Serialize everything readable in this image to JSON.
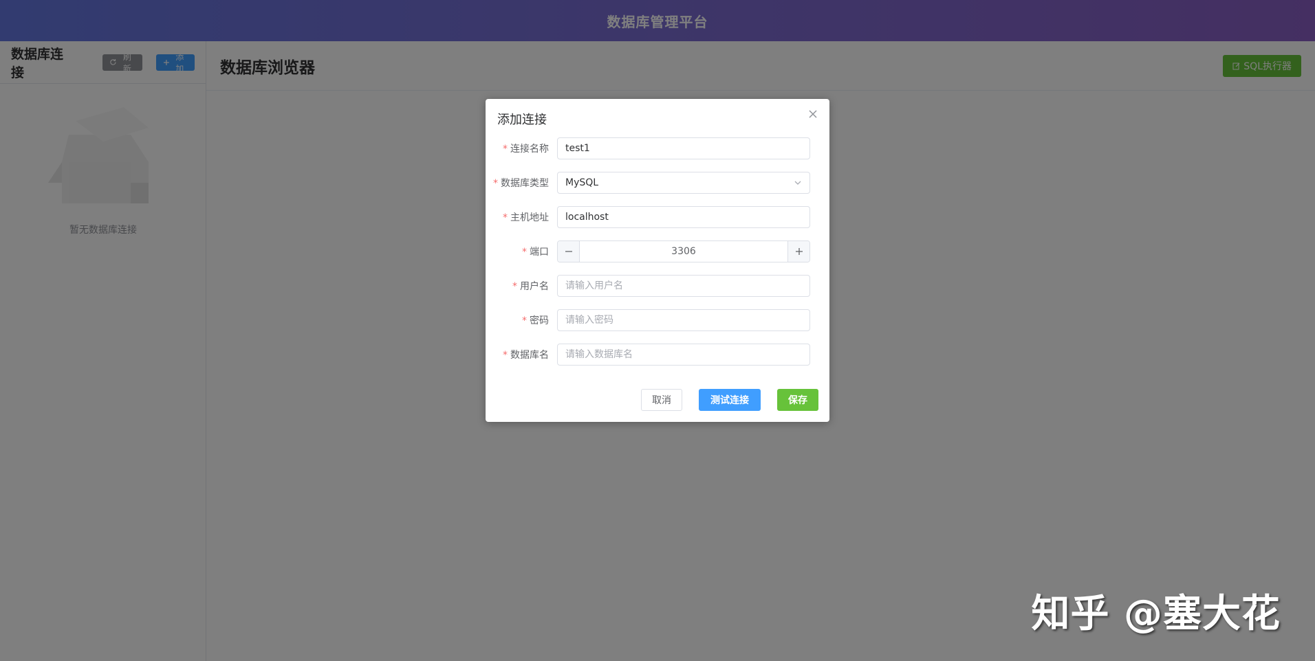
{
  "app": {
    "title": "数据库管理平台"
  },
  "sidebar": {
    "title": "数据库连接",
    "refresh_label": "刷新",
    "add_label": "添加",
    "empty_text": "暂无数据库连接"
  },
  "main": {
    "title": "数据库浏览器",
    "sql_button_label": "SQL执行器"
  },
  "dialog": {
    "title": "添加连接",
    "fields": {
      "name": {
        "label": "连接名称",
        "value": "test1"
      },
      "db_type": {
        "label": "数据库类型",
        "value": "MySQL"
      },
      "host": {
        "label": "主机地址",
        "value": "localhost"
      },
      "port": {
        "label": "端口",
        "value": "3306"
      },
      "username": {
        "label": "用户名",
        "placeholder": "请输入用户名"
      },
      "password": {
        "label": "密码",
        "placeholder": "请输入密码"
      },
      "database": {
        "label": "数据库名",
        "placeholder": "请输入数据库名"
      }
    },
    "buttons": {
      "cancel": "取消",
      "test": "测试连接",
      "save": "保存"
    }
  },
  "watermark": {
    "text": "知乎 @塞大花"
  },
  "colors": {
    "primary": "#409eff",
    "success": "#67c23a",
    "info": "#909399",
    "danger": "#f56c6c"
  },
  "icons": {
    "refresh": "refresh-icon",
    "add": "plus-icon",
    "sql": "edit-icon",
    "close": "close-icon",
    "dropdown": "chevron-down-icon",
    "minus": "minus-icon",
    "plus": "plus-icon"
  }
}
